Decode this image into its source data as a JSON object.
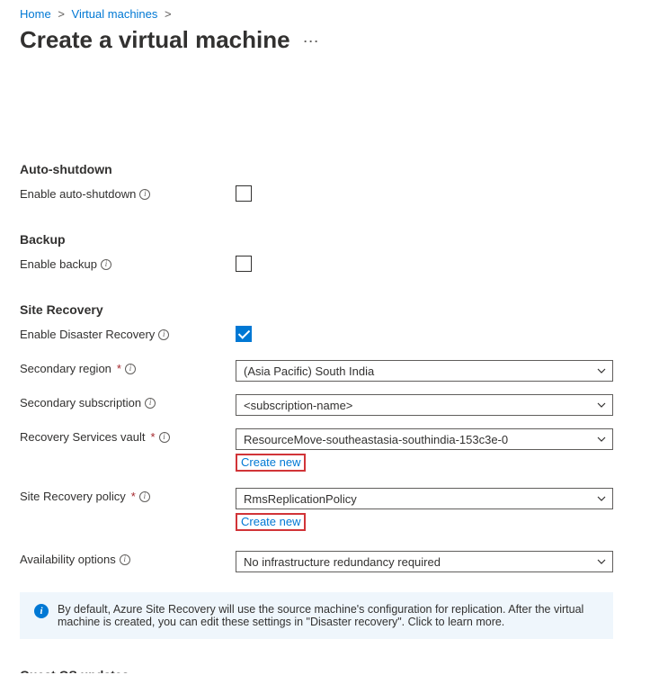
{
  "breadcrumb": {
    "home": "Home",
    "vms": "Virtual machines"
  },
  "page": {
    "title": "Create a virtual machine"
  },
  "sections": {
    "auto_shutdown": {
      "heading": "Auto-shutdown",
      "enable_label": "Enable auto-shutdown",
      "enable_checked": false
    },
    "backup": {
      "heading": "Backup",
      "enable_label": "Enable backup",
      "enable_checked": false
    },
    "site_recovery": {
      "heading": "Site Recovery",
      "enable_label": "Enable Disaster Recovery",
      "enable_checked": true,
      "secondary_region_label": "Secondary region",
      "secondary_region_value": "(Asia Pacific) South India",
      "secondary_subscription_label": "Secondary subscription",
      "secondary_subscription_value": "<subscription-name>",
      "vault_label": "Recovery Services vault",
      "vault_value": "ResourceMove-southeastasia-southindia-153c3e-0",
      "vault_create_new": "Create new",
      "policy_label": "Site Recovery policy",
      "policy_value": "RmsReplicationPolicy",
      "policy_create_new": "Create new",
      "availability_label": "Availability options",
      "availability_value": "No infrastructure redundancy required"
    },
    "banner": {
      "text": "By default, Azure Site Recovery will use the source machine's configuration for replication. After the virtual machine is created, you can edit these settings in \"Disaster recovery\". Click to learn more."
    },
    "truncated_next": "Guest OS updates"
  }
}
